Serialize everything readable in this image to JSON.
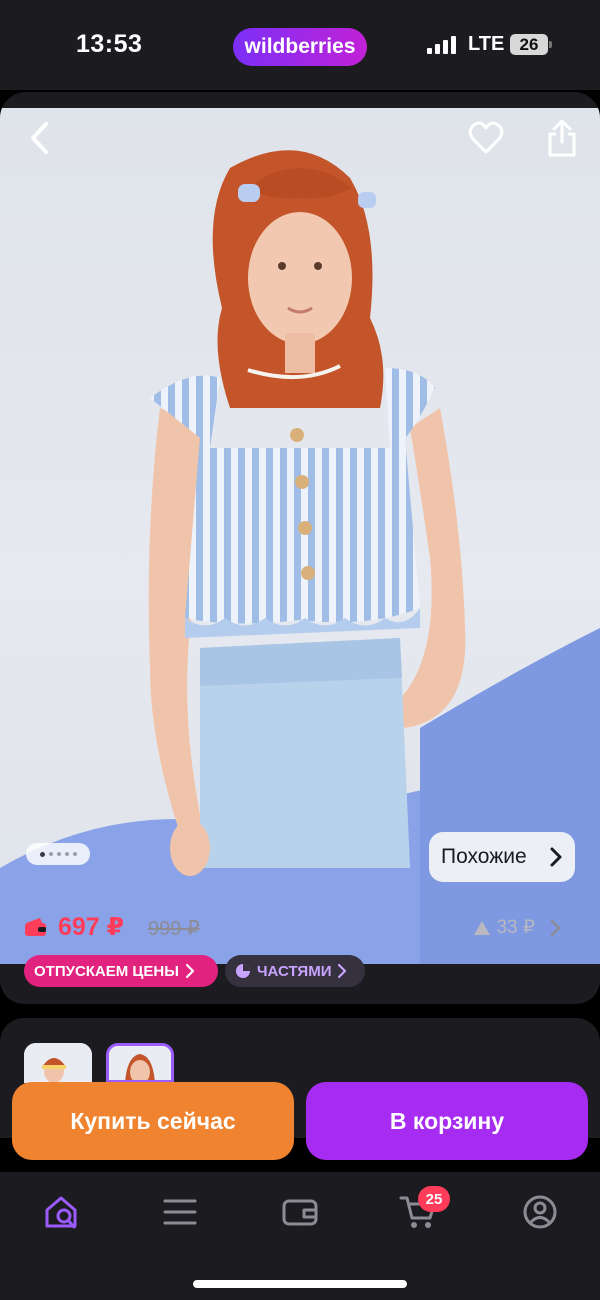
{
  "status_bar": {
    "time": "13:53",
    "brand": "wildberries",
    "network": "LTE",
    "battery": "26"
  },
  "product": {
    "similar_button": "Похожие",
    "gallery_dots": 5,
    "gallery_active_index": 0,
    "price_current": "697 ₽",
    "price_old": "999 ₽",
    "price_diff": "33 ₽",
    "chips": [
      {
        "label": "ОТПУСКАЕМ ЦЕНЫ"
      },
      {
        "label": "ЧАСТЯМИ"
      }
    ]
  },
  "actions": {
    "buy_now": "Купить сейчас",
    "add_to_cart": "В корзину"
  },
  "tab_bar": {
    "items": [
      {
        "icon": "home-search-icon",
        "active": true
      },
      {
        "icon": "catalog-menu-icon",
        "active": false
      },
      {
        "icon": "wallet-icon",
        "active": false
      },
      {
        "icon": "cart-icon",
        "active": false,
        "badge": "25"
      },
      {
        "icon": "profile-icon",
        "active": false
      }
    ]
  },
  "colors": {
    "background": "#1c1b20",
    "price_accent": "#ff3d5a",
    "buy_button": "#f0832f",
    "cart_button": "#a62cf2",
    "sale_chip": "#e2227f",
    "active_tab": "#9a5cff"
  }
}
